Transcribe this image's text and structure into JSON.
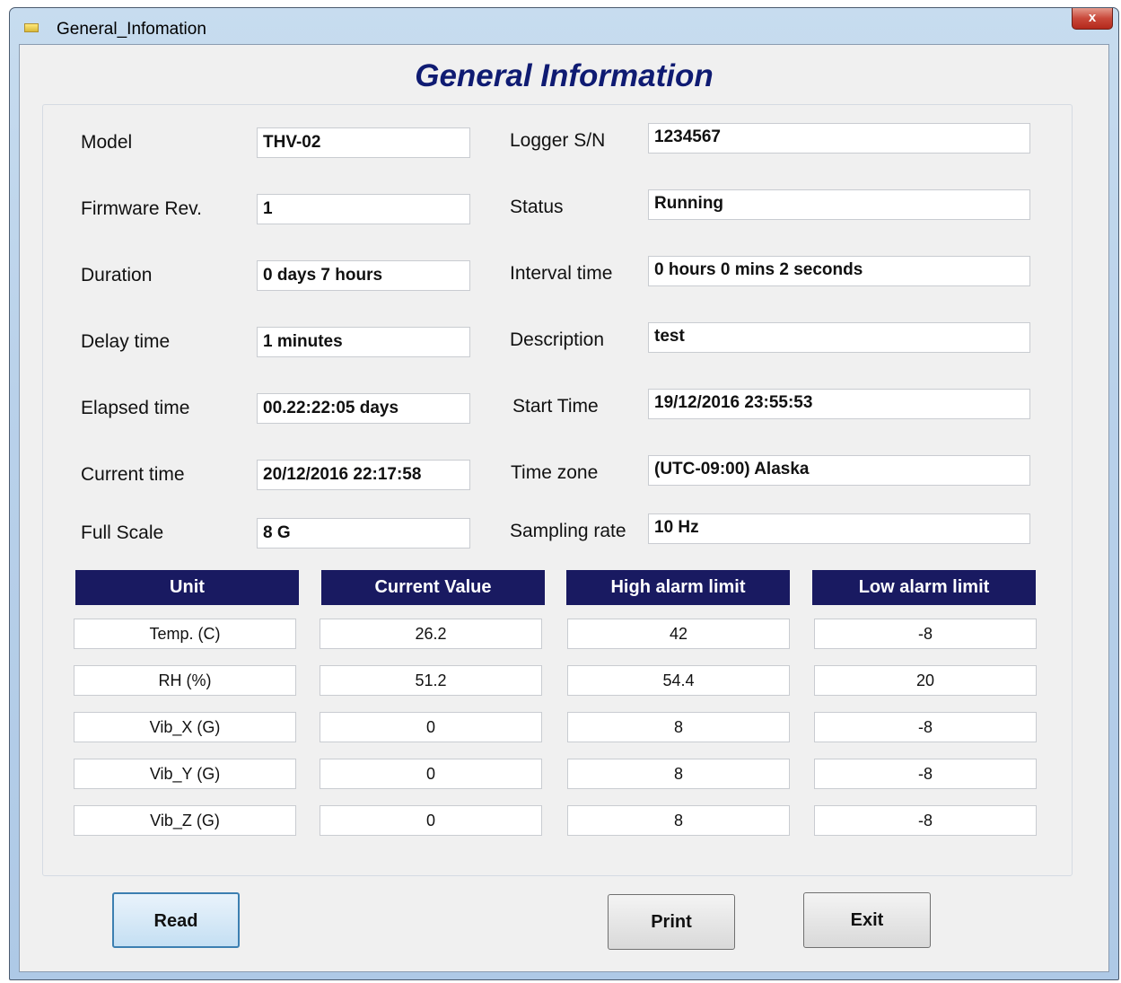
{
  "window": {
    "title": "General_Infomation",
    "close_label": "x"
  },
  "heading": "General Information",
  "info_left": [
    {
      "label": "Model",
      "value": "THV-02"
    },
    {
      "label": "Firmware Rev.",
      "value": "1"
    },
    {
      "label": "Duration",
      "value": "0 days 7 hours"
    },
    {
      "label": "Delay time",
      "value": "1 minutes"
    },
    {
      "label": "Elapsed time",
      "value": "00.22:22:05 days"
    },
    {
      "label": "Current time",
      "value": "20/12/2016 22:17:58"
    },
    {
      "label": "Full Scale",
      "value": "8 G"
    }
  ],
  "info_right": [
    {
      "label": "Logger S/N",
      "value": "1234567"
    },
    {
      "label": "Status",
      "value": "Running"
    },
    {
      "label": "Interval time",
      "value": "0 hours 0 mins 2 seconds"
    },
    {
      "label": "Description",
      "value": "test"
    },
    {
      "label": "Start Time",
      "value": "19/12/2016 23:55:53"
    },
    {
      "label": "Time zone",
      "value": "(UTC-09:00) Alaska"
    },
    {
      "label": "Sampling rate",
      "value": "10 Hz"
    }
  ],
  "table": {
    "headers": [
      "Unit",
      "Current Value",
      "High alarm limit",
      "Low alarm limit"
    ],
    "rows": [
      [
        "Temp. (C)",
        "26.2",
        "42",
        "-8"
      ],
      [
        "RH (%)",
        "51.2",
        "54.4",
        "20"
      ],
      [
        "Vib_X (G)",
        "0",
        "8",
        "-8"
      ],
      [
        "Vib_Y (G)",
        "0",
        "8",
        "-8"
      ],
      [
        "Vib_Z (G)",
        "0",
        "8",
        "-8"
      ]
    ]
  },
  "buttons": {
    "read": "Read",
    "print": "Print",
    "exit": "Exit"
  }
}
